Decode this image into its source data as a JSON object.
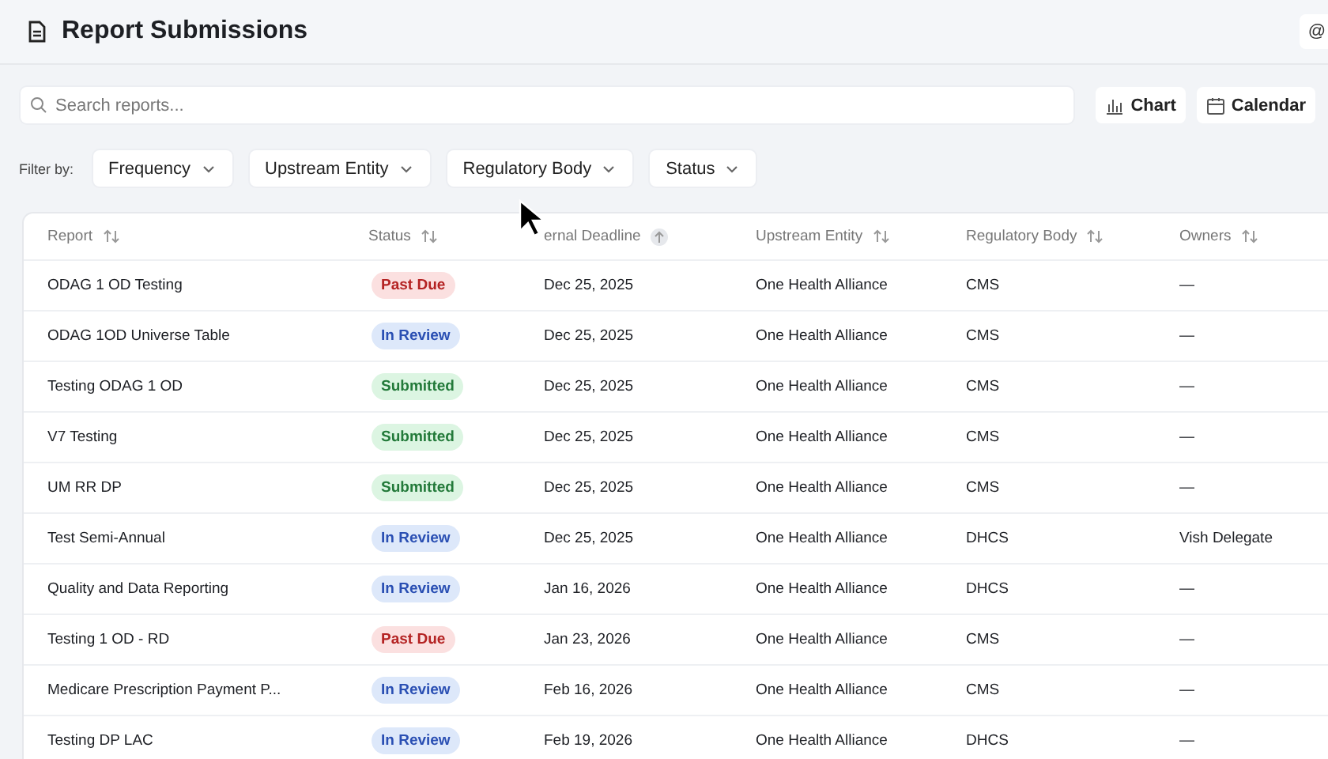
{
  "header": {
    "title": "Report Submissions",
    "corner_button": "@"
  },
  "search": {
    "placeholder": "Search reports..."
  },
  "view_buttons": [
    {
      "kind": "chart",
      "label": "Chart"
    },
    {
      "kind": "calendar",
      "label": "Calendar"
    }
  ],
  "filters": {
    "label": "Filter by:",
    "items": [
      "Frequency",
      "Upstream Entity",
      "Regulatory Body",
      "Status"
    ]
  },
  "table": {
    "columns": [
      {
        "label": "Report",
        "sorted": false
      },
      {
        "label": "Status",
        "sorted": false
      },
      {
        "label": "ernal Deadline",
        "sorted": true
      },
      {
        "label": "Upstream Entity",
        "sorted": false
      },
      {
        "label": "Regulatory Body",
        "sorted": false
      },
      {
        "label": "Owners",
        "sorted": false
      }
    ],
    "rows": [
      {
        "report": "ODAG 1 OD Testing",
        "status": {
          "kind": "past_due",
          "label": "Past Due"
        },
        "deadline": "Dec 25, 2025",
        "entity": "One Health Alliance",
        "body": "CMS",
        "owners": "—"
      },
      {
        "report": "ODAG 1OD Universe Table",
        "status": {
          "kind": "in_review",
          "label": "In Review"
        },
        "deadline": "Dec 25, 2025",
        "entity": "One Health Alliance",
        "body": "CMS",
        "owners": "—"
      },
      {
        "report": "Testing ODAG 1 OD",
        "status": {
          "kind": "submitted",
          "label": "Submitted"
        },
        "deadline": "Dec 25, 2025",
        "entity": "One Health Alliance",
        "body": "CMS",
        "owners": "—"
      },
      {
        "report": "V7 Testing",
        "status": {
          "kind": "submitted",
          "label": "Submitted"
        },
        "deadline": "Dec 25, 2025",
        "entity": "One Health Alliance",
        "body": "CMS",
        "owners": "—"
      },
      {
        "report": "UM RR DP",
        "status": {
          "kind": "submitted",
          "label": "Submitted"
        },
        "deadline": "Dec 25, 2025",
        "entity": "One Health Alliance",
        "body": "CMS",
        "owners": "—"
      },
      {
        "report": "Test Semi-Annual",
        "status": {
          "kind": "in_review",
          "label": "In Review"
        },
        "deadline": "Dec 25, 2025",
        "entity": "One Health Alliance",
        "body": "DHCS",
        "owners": "Vish Delegate"
      },
      {
        "report": "Quality and Data Reporting",
        "status": {
          "kind": "in_review",
          "label": "In Review"
        },
        "deadline": "Jan 16, 2026",
        "entity": "One Health Alliance",
        "body": "DHCS",
        "owners": "—"
      },
      {
        "report": "Testing 1 OD - RD",
        "status": {
          "kind": "past_due",
          "label": "Past Due"
        },
        "deadline": "Jan 23, 2026",
        "entity": "One Health Alliance",
        "body": "CMS",
        "owners": "—"
      },
      {
        "report": "Medicare Prescription Payment P...",
        "status": {
          "kind": "in_review",
          "label": "In Review"
        },
        "deadline": "Feb 16, 2026",
        "entity": "One Health Alliance",
        "body": "CMS",
        "owners": "—"
      },
      {
        "report": "Testing DP LAC",
        "status": {
          "kind": "in_review",
          "label": "In Review"
        },
        "deadline": "Feb 19, 2026",
        "entity": "One Health Alliance",
        "body": "DHCS",
        "owners": "—"
      }
    ]
  }
}
